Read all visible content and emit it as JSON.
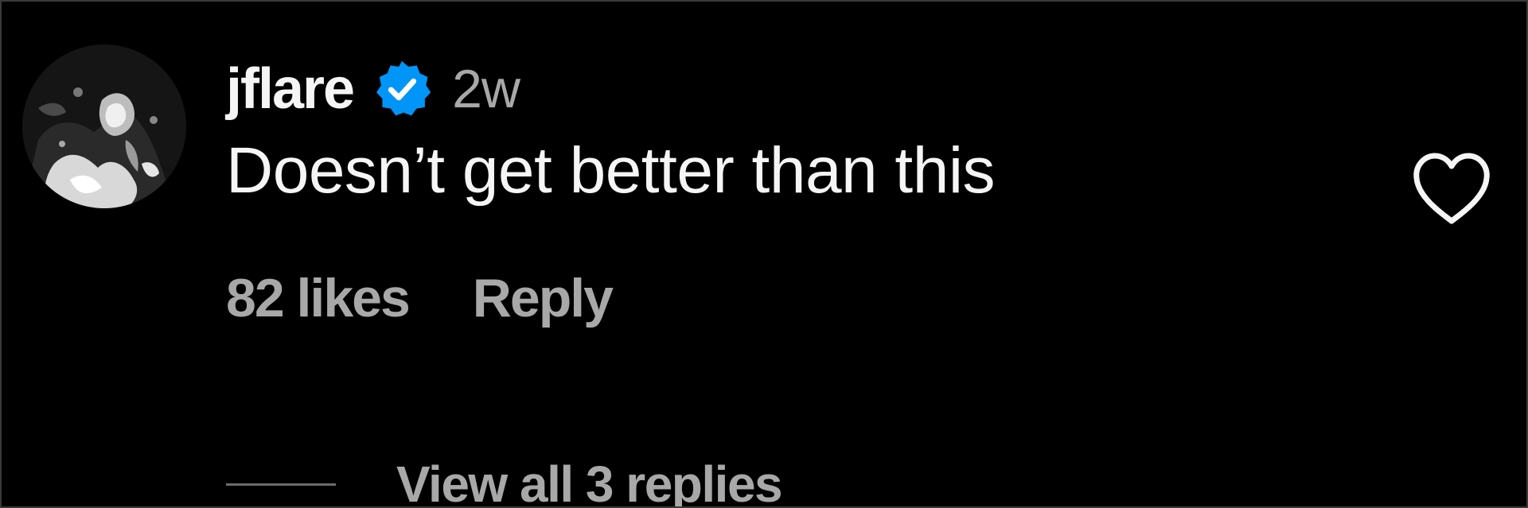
{
  "comment": {
    "username": "jflare",
    "verified": true,
    "timestamp": "2w",
    "text": "Doesn’t get better than this",
    "likes_label": "82 likes",
    "reply_label": "Reply",
    "view_replies_label": "View all 3 replies"
  },
  "icons": {
    "verified": "verified-badge-icon",
    "like": "heart-outline-icon"
  },
  "colors": {
    "background": "#000000",
    "primary_text": "#f5f5f5",
    "secondary_text": "#a8a8a8",
    "verified_blue": "#0095f6"
  }
}
